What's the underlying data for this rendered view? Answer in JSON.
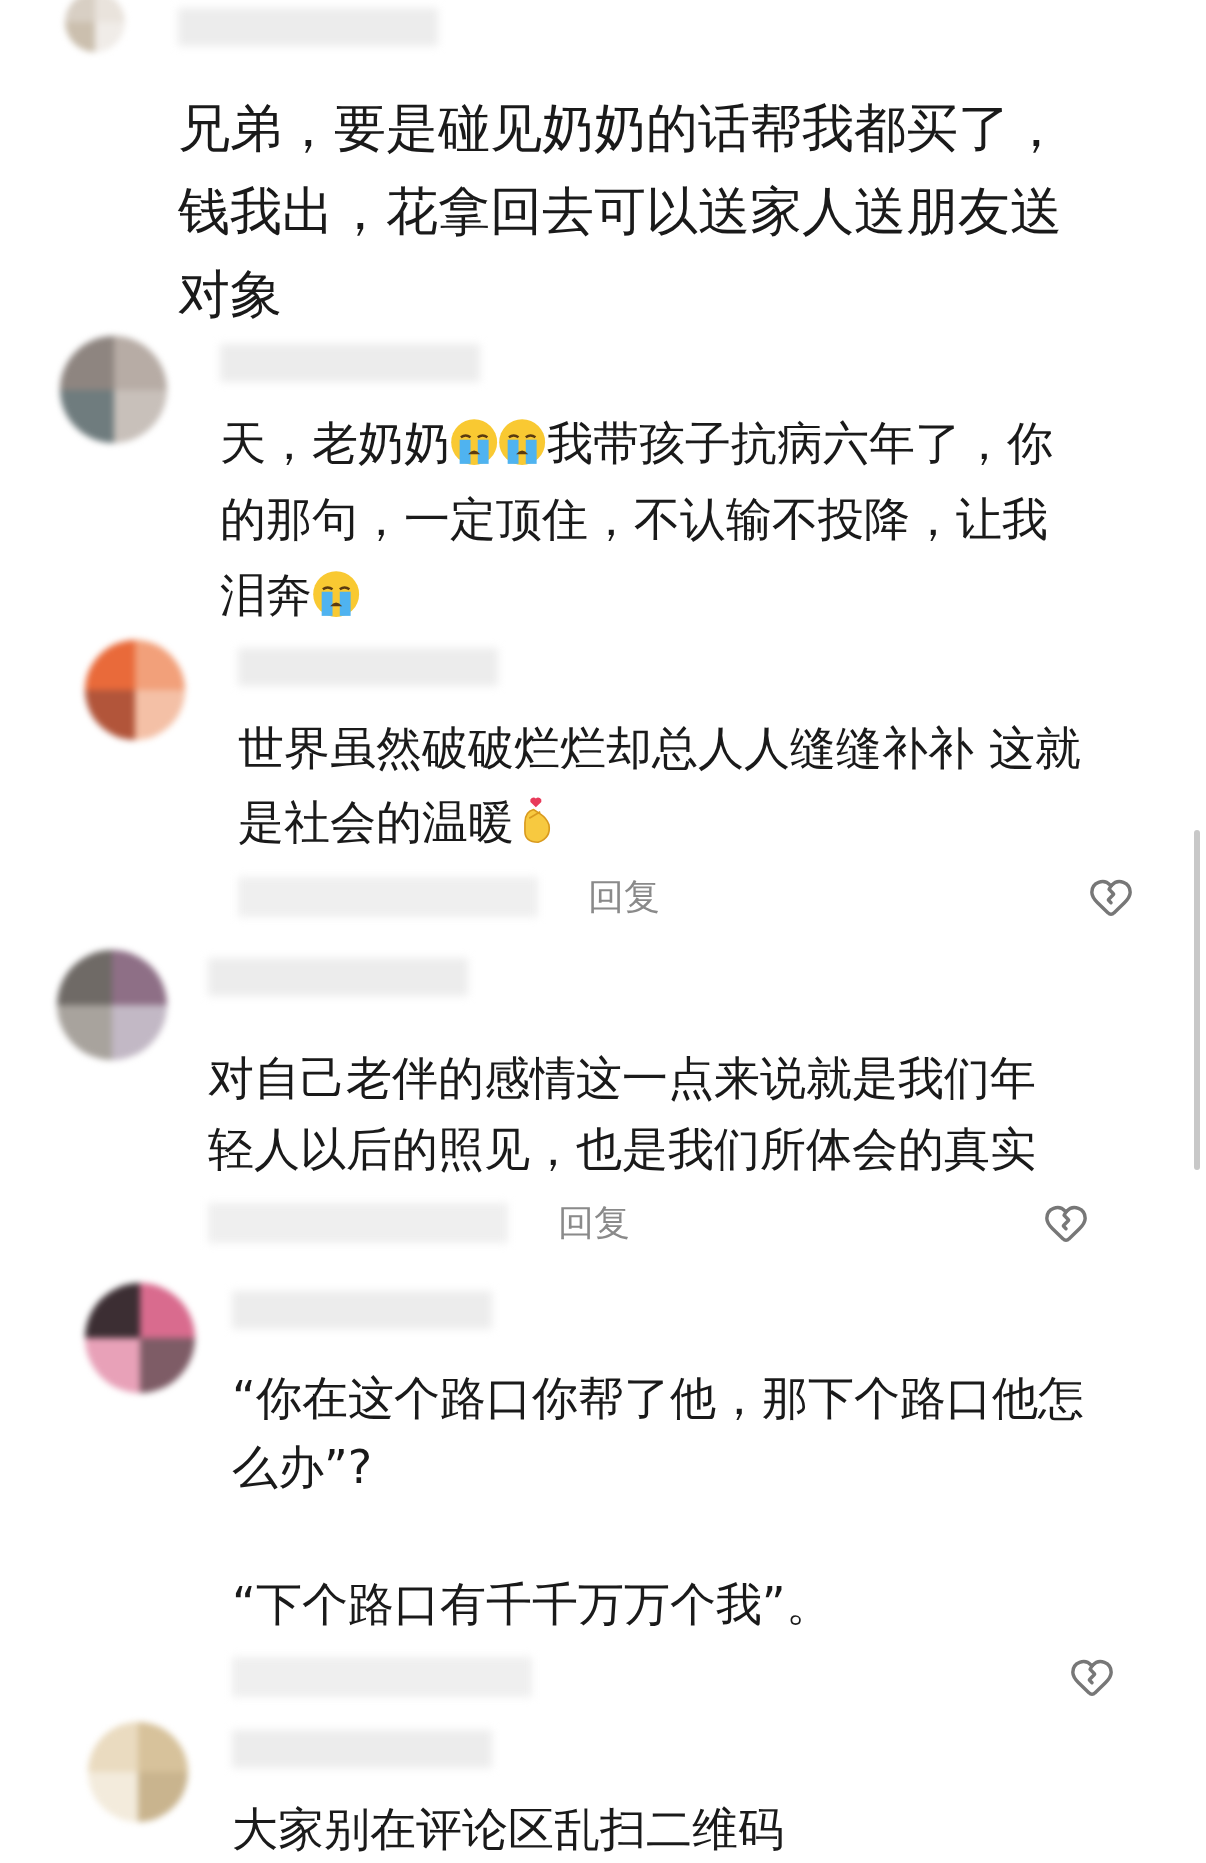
{
  "comments": [
    {
      "paragraphs": [
        [
          {
            "kind": "text",
            "text": "兄弟，要是碰见奶奶的话帮我都买了，钱我出，花拿回去可以送家人送朋友送对象"
          }
        ]
      ]
    },
    {
      "paragraphs": [
        [
          {
            "kind": "text",
            "text": "天，老奶奶"
          },
          {
            "kind": "cry-emoji"
          },
          {
            "kind": "cry-emoji"
          },
          {
            "kind": "text",
            "text": "我带孩子抗病六年了，你的那句，一定顶住，不认输不投降，让我泪奔"
          },
          {
            "kind": "cry-emoji"
          }
        ]
      ]
    },
    {
      "paragraphs": [
        [
          {
            "kind": "text",
            "text": "世界虽然破破烂烂却总人人缝缝补补 这就是社会的温暖"
          },
          {
            "kind": "finger-heart-emoji"
          }
        ]
      ],
      "reply": "回复",
      "like_icon": true
    },
    {
      "paragraphs": [
        [
          {
            "kind": "text",
            "text": "对自己老伴的感情这一点来说就是我们年轻人以后的照见，也是我们所体会的真实"
          }
        ]
      ],
      "reply": "回复",
      "like_icon": true
    },
    {
      "paragraphs": [
        [
          {
            "kind": "text",
            "text": "“你在这个路口你帮了他，那下个路口他怎么办”?"
          }
        ],
        [
          {
            "kind": "text",
            "text": "“下个路口有千千万万个我”。"
          }
        ]
      ],
      "like_icon": true
    },
    {
      "paragraphs": [
        [
          {
            "kind": "text",
            "text": "大家别在评论区乱扫二维码"
          }
        ]
      ]
    }
  ]
}
